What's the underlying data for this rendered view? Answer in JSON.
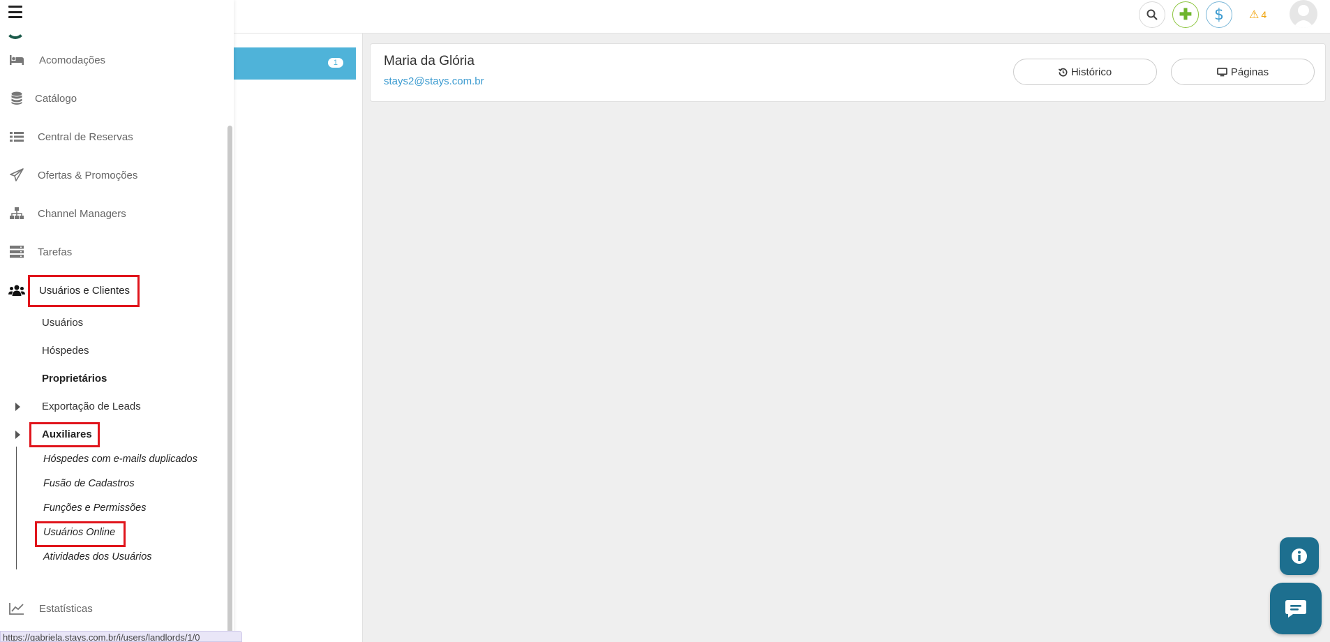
{
  "topbar": {
    "search_icon": "search-icon",
    "add_icon": "plus-icon",
    "add_glyph": "✚",
    "money_glyph": "$",
    "alert_glyph": "⚠",
    "alert_count": "4",
    "colors": {
      "add": "#6eb52c",
      "money": "#3c9bd0",
      "alert": "#f0a30a"
    }
  },
  "list": {
    "badge": "1",
    "active_color": "#4fb3d9"
  },
  "profile": {
    "name": "Maria da Glória",
    "email": "stays2@stays.com.br",
    "history_label": "Histórico",
    "pages_label": "Páginas"
  },
  "sidebar": {
    "items": [
      {
        "label": "Acomodações",
        "icon": "bed-icon"
      },
      {
        "label": "Catálogo",
        "icon": "database-icon"
      },
      {
        "label": "Central de Reservas",
        "icon": "list-icon"
      },
      {
        "label": "Ofertas & Promoções",
        "icon": "paper-plane-icon"
      },
      {
        "label": "Channel Managers",
        "icon": "sitemap-icon"
      },
      {
        "label": "Tarefas",
        "icon": "server-icon"
      },
      {
        "label": "Usuários e Clientes",
        "icon": "users-icon"
      },
      {
        "label": "Estatísticas",
        "icon": "line-chart-icon"
      }
    ],
    "sub_items": [
      "Usuários",
      "Hóspedes",
      "Proprietários",
      "Exportação de Leads",
      "Auxiliares"
    ],
    "aux_items": [
      "Hóspedes com e-mails duplicados",
      "Fusão de Cadastros",
      "Funções e Permissões",
      "Usuários Online",
      "Atividades dos Usuários"
    ]
  },
  "status_bar": {
    "url": "https://gabriela.stays.com.br/i/users/landlords/1/0"
  },
  "highlight_color": "#e0151c"
}
